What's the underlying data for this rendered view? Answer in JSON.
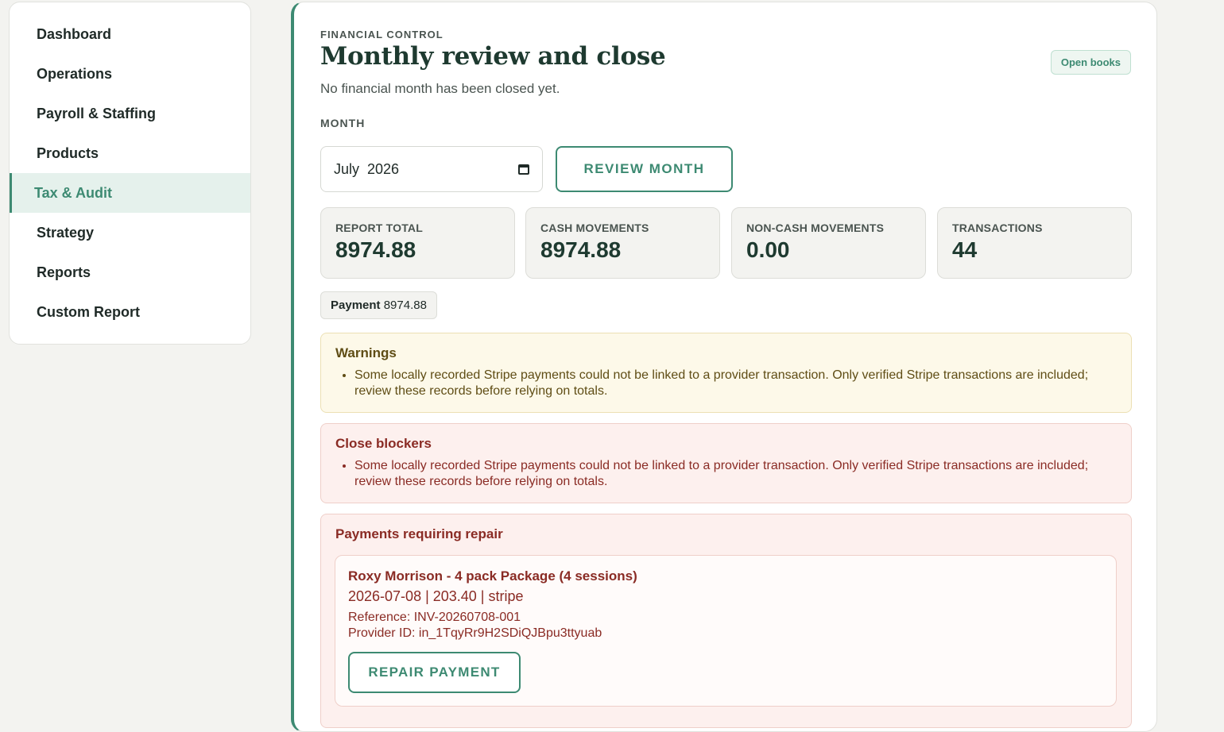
{
  "sidebar": {
    "items": [
      {
        "label": "Dashboard",
        "active": false
      },
      {
        "label": "Operations",
        "active": false
      },
      {
        "label": "Payroll & Staffing",
        "active": false
      },
      {
        "label": "Products",
        "active": false
      },
      {
        "label": "Tax & Audit",
        "active": true
      },
      {
        "label": "Strategy",
        "active": false
      },
      {
        "label": "Reports",
        "active": false
      },
      {
        "label": "Custom Report",
        "active": false
      }
    ]
  },
  "header": {
    "eyebrow": "FINANCIAL CONTROL",
    "title": "Monthly review and close",
    "subtitle": "No financial month has been closed yet.",
    "badge": "Open books"
  },
  "month": {
    "label": "MONTH",
    "value": "July  2026",
    "calendar_icon": "calendar-icon",
    "review_button": "REVIEW MONTH"
  },
  "stats": [
    {
      "label": "REPORT TOTAL",
      "value": "8974.88"
    },
    {
      "label": "CASH MOVEMENTS",
      "value": "8974.88"
    },
    {
      "label": "NON-CASH MOVEMENTS",
      "value": "0.00"
    },
    {
      "label": "TRANSACTIONS",
      "value": "44"
    }
  ],
  "breakdown": {
    "method": "Payment",
    "amount": "8974.88"
  },
  "warnings": {
    "title": "Warnings",
    "items": [
      "Some locally recorded Stripe payments could not be linked to a provider transaction. Only verified Stripe transactions are included; review these records before relying on totals."
    ]
  },
  "blockers": {
    "title": "Close blockers",
    "items": [
      "Some locally recorded Stripe payments could not be linked to a provider transaction. Only verified Stripe transactions are included; review these records before relying on totals."
    ]
  },
  "repair": {
    "title": "Payments requiring repair",
    "payment": {
      "name": "Roxy Morrison - 4 pack Package (4 sessions)",
      "meta": "2026-07-08 | 203.40 | stripe",
      "reference": "Reference: INV-20260708-001",
      "provider": "Provider ID: in_1TqyRr9H2SDiQJBpu3ttyuab",
      "button": "REPAIR PAYMENT"
    }
  },
  "colors": {
    "accent": "#3d8a72",
    "warning_bg": "#fdf9e9",
    "danger_bg": "#fdf0ee",
    "danger_text": "#8a2b24"
  }
}
